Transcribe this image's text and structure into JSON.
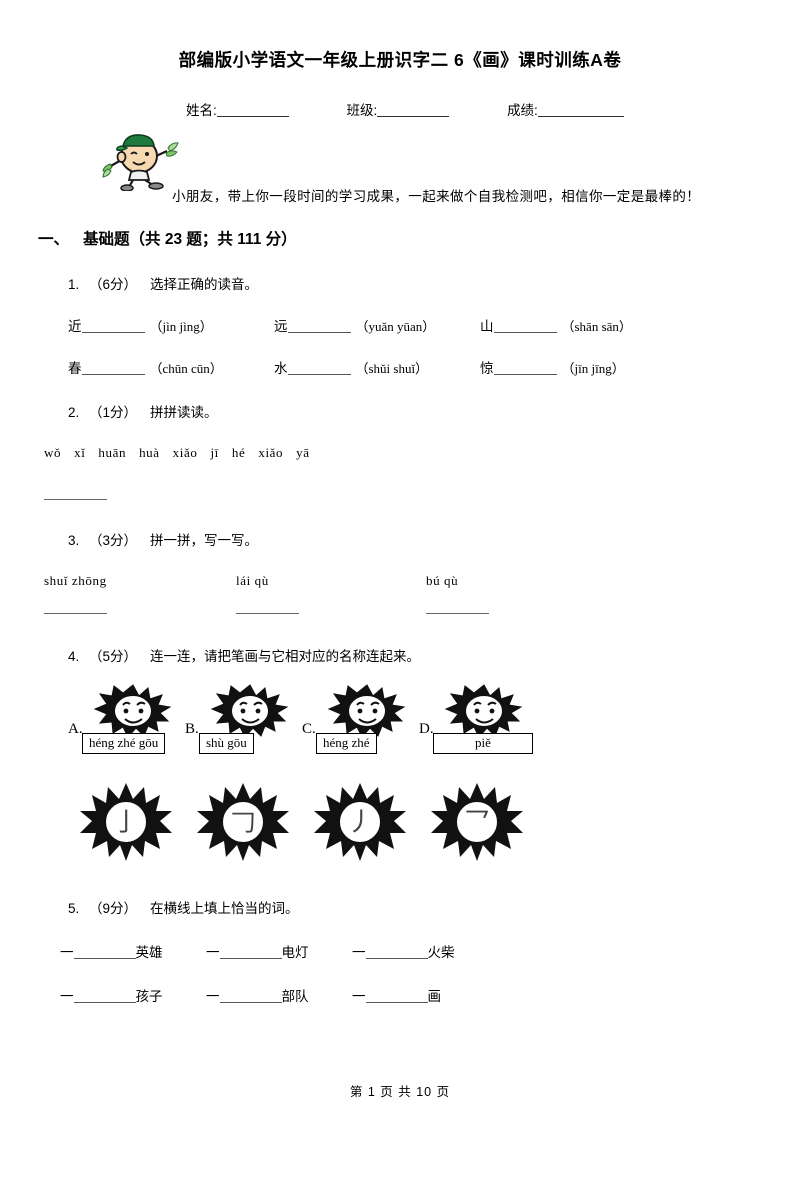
{
  "document": {
    "title": "部编版小学语文一年级上册识字二 6《画》课时训练A卷",
    "footer": "第 1 页  共 10 页"
  },
  "student_info": {
    "name_label": "姓名:",
    "class_label": "班级:",
    "score_label": "成绩:"
  },
  "greeting": {
    "text": "小朋友，带上你一段时间的学习成果，一起来做个自我检测吧，相信你一定是最棒的！",
    "mascot": "cartoon-boy-waving-green-cap"
  },
  "section": {
    "number": "一、",
    "title": "基础题",
    "meta": "（共 23 题；共 111 分）"
  },
  "questions": [
    {
      "no": "1.",
      "points": "（6分）",
      "prompt": "选择正确的读音。",
      "rows": [
        [
          {
            "char": "近",
            "options": "（jìn  jìng）"
          },
          {
            "char": "远",
            "options": "（yuǎn  yūan）"
          },
          {
            "char": "山",
            "options": "（shān  sān）"
          }
        ],
        [
          {
            "char": "春",
            "options": "（chūn  cūn）"
          },
          {
            "char": "水",
            "options": "（shǔi  shuǐ）"
          },
          {
            "char": "惊",
            "options": "（jīn  jīng）"
          }
        ]
      ]
    },
    {
      "no": "2.",
      "points": "（1分）",
      "prompt": "拼拼读读。",
      "pinyin": [
        "wǒ",
        "xǐ",
        "huān",
        "huà",
        "xiǎo",
        "jī",
        "hé",
        "xiǎo",
        "yā"
      ]
    },
    {
      "no": "3.",
      "points": "（3分）",
      "prompt": "拼一拼，写一写。",
      "pinyin_groups": [
        "shuǐ  zhōng",
        "lái  qù",
        "bú  qù"
      ]
    },
    {
      "no": "4.",
      "points": "（5分）",
      "prompt": "连一连，请把笔画与它相对应的名称连起来。",
      "name_options": [
        {
          "letter": "A.",
          "pinyin": "héng zhé gōu"
        },
        {
          "letter": "B.",
          "pinyin": "shù  gōu"
        },
        {
          "letter": "C.",
          "pinyin": "héng zhé"
        },
        {
          "letter": "D.",
          "pinyin": "piě"
        }
      ],
      "stroke_options": [
        {
          "stroke": "亅",
          "name": "vertical-hook-stroke"
        },
        {
          "stroke": "𠃌",
          "name": "horizontal-bend-stroke"
        },
        {
          "stroke": "丿",
          "name": "pie-slanting-stroke"
        },
        {
          "stroke": "乛",
          "name": "horizontal-bend-hook-stroke"
        }
      ]
    },
    {
      "no": "5.",
      "points": "（9分）",
      "prompt": "在横线上填上恰当的词。",
      "rows": [
        [
          {
            "prefix": "一",
            "word": "英雄"
          },
          {
            "prefix": "一",
            "word": "电灯"
          },
          {
            "prefix": "一",
            "word": "火柴"
          }
        ],
        [
          {
            "prefix": "一",
            "word": "孩子"
          },
          {
            "prefix": "一",
            "word": "部队"
          },
          {
            "prefix": "一",
            "word": "画"
          }
        ]
      ]
    }
  ]
}
